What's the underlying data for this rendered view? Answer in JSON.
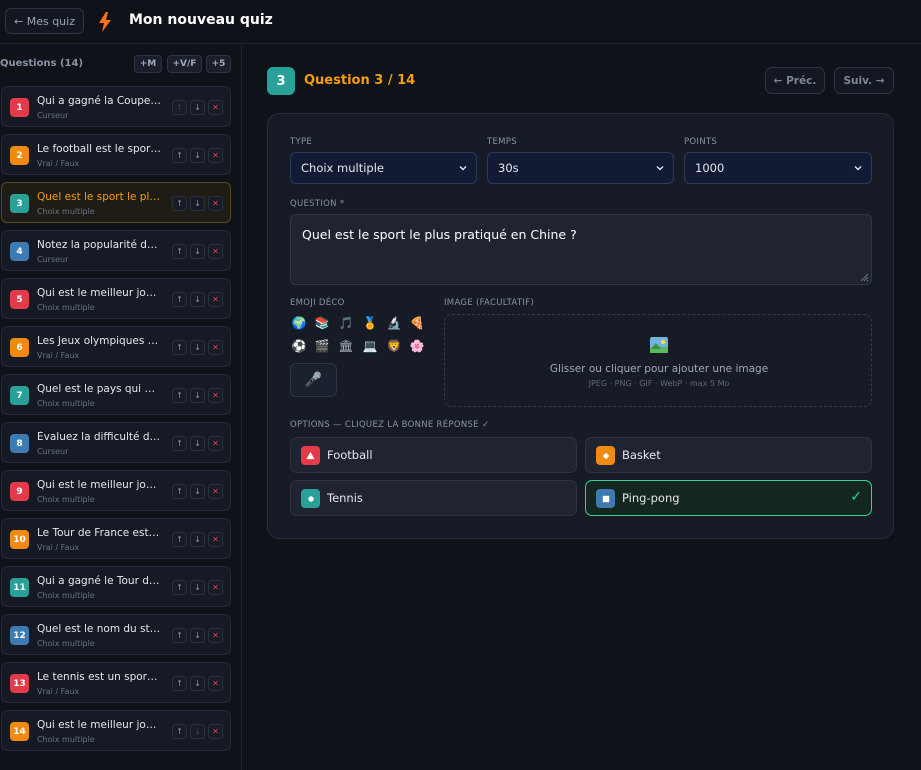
{
  "header": {
    "back_label": "← Mes quiz",
    "title": "Mon nouveau quiz",
    "accent": "#f97316"
  },
  "sidebar": {
    "title": "Questions (14)",
    "add_buttons": [
      "+M",
      "+V/F",
      "+5"
    ],
    "questions": [
      {
        "num": "1",
        "text": "Qui a gagné la Coupe du monde...",
        "type": "Curseur",
        "color": "#e23b4a"
      },
      {
        "num": "2",
        "text": "Le football est le sport le plus...",
        "type": "Vrai / Faux",
        "color": "#f08a12"
      },
      {
        "num": "3",
        "text": "Quel est le sport le plus pratiqué...",
        "type": "Choix multiple",
        "color": "#2aa198",
        "active": true
      },
      {
        "num": "4",
        "text": "Notez la popularité du rugby...",
        "type": "Curseur",
        "color": "#3e7bb0"
      },
      {
        "num": "5",
        "text": "Qui est le meilleur joueur...",
        "type": "Choix multiple",
        "color": "#e23b4a"
      },
      {
        "num": "6",
        "text": "Les Jeux olympiques ont lieu...",
        "type": "Vrai / Faux",
        "color": "#f08a12"
      },
      {
        "num": "7",
        "text": "Quel est le pays qui a remporté...",
        "type": "Choix multiple",
        "color": "#2aa198"
      },
      {
        "num": "8",
        "text": "Évaluez la difficulté du marathon...",
        "type": "Curseur",
        "color": "#3e7bb0"
      },
      {
        "num": "9",
        "text": "Qui est le meilleur joueur de...",
        "type": "Choix multiple",
        "color": "#e23b4a"
      },
      {
        "num": "10",
        "text": "Le Tour de France est la course...",
        "type": "Vrai / Faux",
        "color": "#f08a12"
      },
      {
        "num": "11",
        "text": "Qui a gagné le Tour de France...",
        "type": "Choix multiple",
        "color": "#2aa198"
      },
      {
        "num": "12",
        "text": "Quel est le nom du stade...",
        "type": "Choix multiple",
        "color": "#3e7bb0"
      },
      {
        "num": "13",
        "text": "Le tennis est un sport d'origine...",
        "type": "Vrai / Faux",
        "color": "#e23b4a"
      },
      {
        "num": "14",
        "text": "Qui est le meilleur joueur de...",
        "type": "Choix multiple",
        "color": "#f08a12"
      }
    ]
  },
  "editor": {
    "number": "3",
    "heading": "Question 3 / 14",
    "prev_label": "← Préc.",
    "next_label": "Suiv. →",
    "type_label": "TYPE",
    "type_value": "Choix multiple",
    "time_label": "TEMPS",
    "time_value": "30s",
    "points_label": "POINTS",
    "points_value": "1000",
    "question_label": "QUESTION *",
    "question_value": "Quel est le sport le plus pratiqué en Chine ?",
    "emoji_label": "EMOJI DÉCO",
    "emojis": [
      "🌍",
      "📚",
      "🎵",
      "🏅",
      "🔬",
      "🍕",
      "⚽",
      "🎬",
      "🏛",
      "💻",
      "🦁",
      "🌸"
    ],
    "mic_emoji": "🎤",
    "image_label": "IMAGE (FACULTATIF)",
    "image_hint": "Glisser ou cliquer pour ajouter une image",
    "image_sub": "JPEG · PNG · GIF · WebP · max 5 Mo",
    "options_label": "OPTIONS — CLIQUEZ LA BONNE RÉPONSE ✓",
    "options": [
      {
        "label": "Football",
        "icon": "triangle-icon",
        "color": "#e23b4a",
        "correct": false
      },
      {
        "label": "Basket",
        "icon": "diamond-icon",
        "color": "#f08a12",
        "correct": false
      },
      {
        "label": "Tennis",
        "icon": "circle-icon",
        "color": "#2aa198",
        "correct": false
      },
      {
        "label": "Ping-pong",
        "icon": "square-icon",
        "color": "#3e7bb0",
        "correct": true
      }
    ],
    "correct_mark": "✓"
  }
}
